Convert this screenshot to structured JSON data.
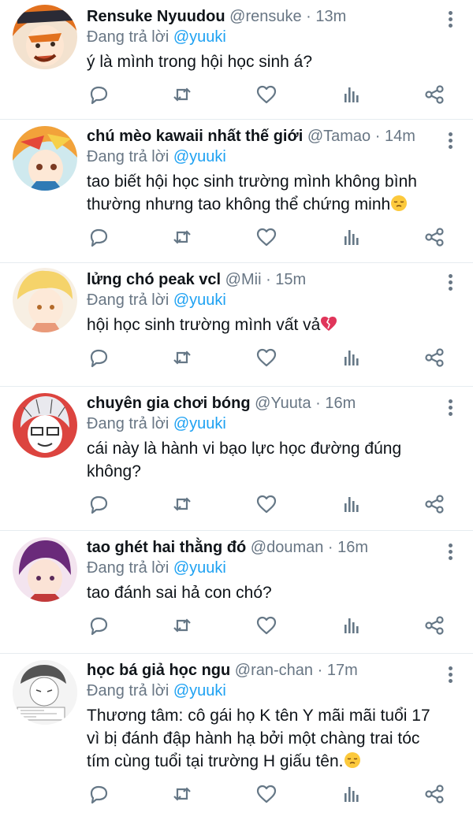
{
  "colors": {
    "text": "#0f1419",
    "secondary": "#687684",
    "link": "#1da1f2",
    "divider": "#e6ecf0",
    "icon": "#657786"
  },
  "action_icons": [
    "reply-icon",
    "retweet-icon",
    "like-icon",
    "analytics-icon",
    "share-icon"
  ],
  "replies": [
    {
      "name": "Rensuke Nyuudou",
      "handle": "@rensuke",
      "time": "13m",
      "replying_label": "Đang trả lời",
      "replying_to": "@yuuki",
      "text": "ý là mình trong hội học sinh á?",
      "emoji": ""
    },
    {
      "name": "chú mèo kawaii nhất thế giới",
      "handle": "@Tamao",
      "time": "14m",
      "replying_label": "Đang trả lời",
      "replying_to": "@yuuki",
      "text": "tao biết hội học sinh trường mình không bình thường nhưng tao không thể chứng minh",
      "emoji": "pensive-face"
    },
    {
      "name": "lửng chó peak vcl",
      "handle": "@Mii",
      "time": "15m",
      "replying_label": "Đang trả lời",
      "replying_to": "@yuuki",
      "text": "hội học sinh trường mình vất vả",
      "emoji": "broken-heart"
    },
    {
      "name": "chuyên gia chơi bóng",
      "handle": "@Yuuta",
      "time": "16m",
      "replying_label": "Đang trả lời",
      "replying_to": "@yuuki",
      "text": "cái này là hành vi bạo lực học đường đúng không?",
      "emoji": ""
    },
    {
      "name": "tao ghét hai thằng đó",
      "handle": "@douman",
      "time": "16m",
      "replying_label": "Đang trả lời",
      "replying_to": "@yuuki",
      "text": "tao đánh sai hả con chó?",
      "emoji": ""
    },
    {
      "name": "học bá giả học ngu",
      "handle": "@ran-chan",
      "time": "17m",
      "replying_label": "Đang trả lời",
      "replying_to": "@yuuki",
      "text": "Thương tâm: cô gái họ K tên Y mãi mãi tuổi 17 vì bị đánh đập hành hạ bởi một chàng trai tóc tím cùng tuổi tại trường H giấu tên.",
      "emoji": "pensive-face"
    }
  ]
}
